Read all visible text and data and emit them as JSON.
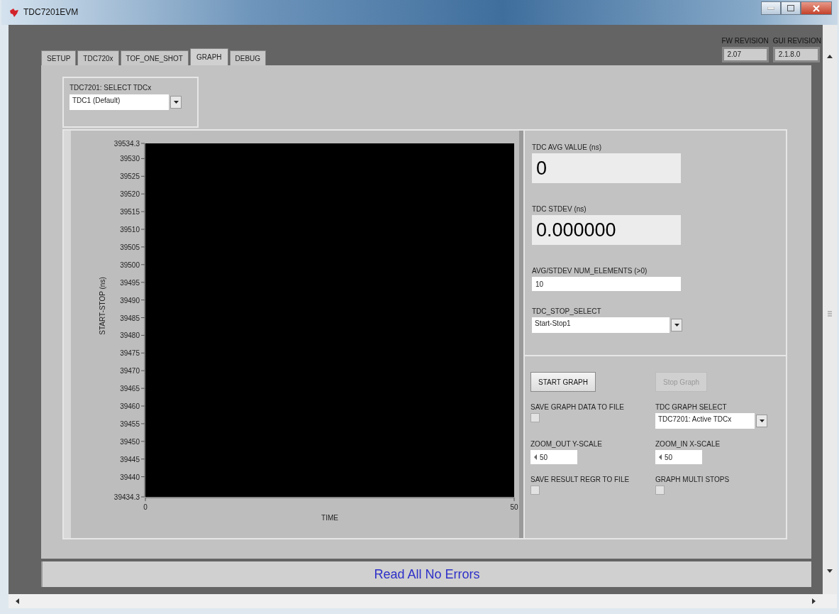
{
  "window": {
    "title": "TDC7201EVM"
  },
  "revisions": [
    {
      "label": "FW REVISION",
      "value": "2.07"
    },
    {
      "label": "GUI REVISION",
      "value": "2.1.8.0"
    }
  ],
  "tabs": [
    {
      "label": "SETUP",
      "selected": false
    },
    {
      "label": "TDC720x",
      "selected": false
    },
    {
      "label": "TOF_ONE_SHOT",
      "selected": false
    },
    {
      "label": "GRAPH",
      "selected": true
    },
    {
      "label": "DEBUG",
      "selected": false
    }
  ],
  "tdc_select": {
    "label": "TDC7201: SELECT TDCx",
    "value": "TDC1 (Default)"
  },
  "chart": {
    "chart_data": {
      "type": "line",
      "xlabel": "TIME",
      "ylabel": "START-STOP (ns)",
      "xlim": [
        0,
        50
      ],
      "ylim": [
        39434.3,
        39534.3
      ],
      "xticks": [
        0,
        50
      ],
      "yticks": [
        39434.3,
        39440,
        39445,
        39450,
        39455,
        39460,
        39465,
        39470,
        39475,
        39480,
        39485,
        39490,
        39495,
        39500,
        39505,
        39510,
        39515,
        39520,
        39525,
        39530,
        39534.3
      ]
    }
  },
  "readouts": [
    {
      "label": "TDC AVG VALUE (ns)",
      "value": "0"
    },
    {
      "label": "TDC STDEV (ns)",
      "value": "0.000000"
    }
  ],
  "num_elements": {
    "label": "AVG/STDEV NUM_ELEMENTS (>0)",
    "value": "10"
  },
  "stop_select": {
    "label": "TDC_STOP_SELECT",
    "value": "Start-Stop1"
  },
  "buttons": [
    {
      "label": "START GRAPH",
      "disabled": false
    },
    {
      "label": "Stop Graph",
      "disabled": true
    }
  ],
  "save_graph": {
    "label": "SAVE GRAPH DATA TO FILE",
    "checked": false
  },
  "graph_select": {
    "label": "TDC GRAPH SELECT",
    "value": "TDC7201: Active TDCx"
  },
  "zoom_fields": [
    {
      "label": "ZOOM_OUT Y-SCALE",
      "value": "50"
    },
    {
      "label": "ZOOM_IN X-SCALE",
      "value": "50"
    }
  ],
  "check_options": [
    {
      "label": "SAVE RESULT REGR TO FILE",
      "checked": false
    },
    {
      "label": "GRAPH MULTI STOPS",
      "checked": false
    }
  ],
  "status_bar": {
    "message": "Read All No Errors"
  }
}
